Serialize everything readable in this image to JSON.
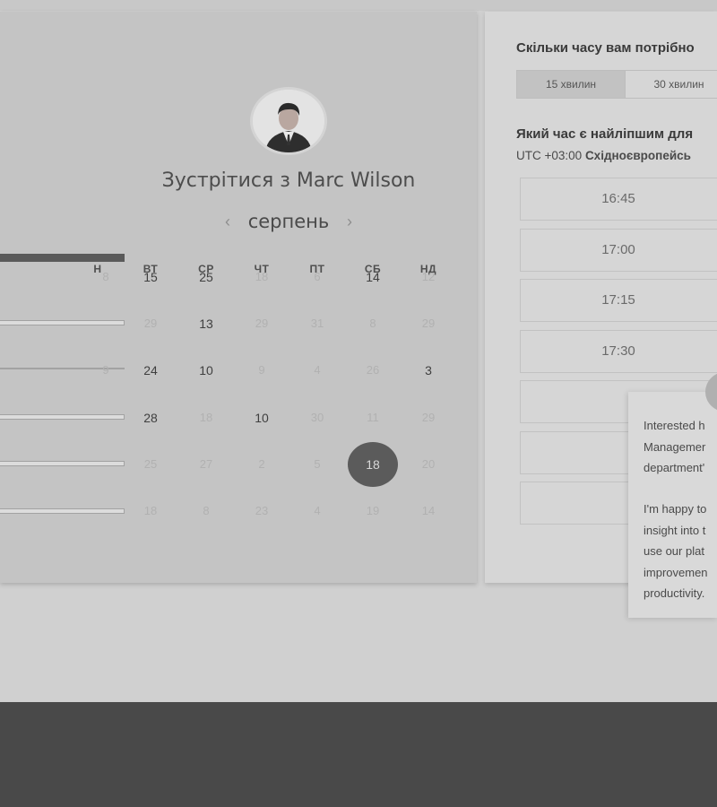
{
  "calendar": {
    "title": "Зустрітися з Marc Wilson",
    "month": "серпень",
    "prev_icon": "‹",
    "next_icon": "›",
    "weekdays": [
      "Н",
      "ВТ",
      "СР",
      "ЧТ",
      "ПТ",
      "СБ",
      "НД"
    ],
    "weeks": [
      [
        "8",
        "15",
        "25",
        "18",
        "6",
        "14",
        "12"
      ],
      [
        "29",
        "13",
        "29",
        "31",
        "8",
        "29"
      ],
      [
        "9",
        "24",
        "10",
        "9",
        "4",
        "26",
        "3"
      ],
      [
        "28",
        "18",
        "10",
        "30",
        "11",
        "29"
      ],
      [
        "25",
        "27",
        "2",
        "5",
        "18",
        "20"
      ],
      [
        "18",
        "8",
        "23",
        "4",
        "19",
        "14"
      ]
    ],
    "selected_day": "18"
  },
  "scheduler": {
    "duration_question": "Скільки часу вам потрібно",
    "durations": [
      "15 хвилин",
      "30 хвилин"
    ],
    "active_duration": "15 хвилин",
    "time_question": "Який час є найліпшим для",
    "timezone_prefix": "UTC +03:00",
    "timezone_name": "Східноєвропейсь",
    "slots": [
      "16:45",
      "17:00",
      "17:15",
      "17:30",
      "",
      "",
      ""
    ]
  },
  "chat": {
    "paragraph_1": "Interested h\nManagemer\ndepartment'",
    "paragraph_2": "I'm happy to\ninsight into t\nuse our plat\nimprovemen\nproductivity."
  },
  "colors": {
    "selected_day": "#5b5b5b",
    "footer": "#494949"
  }
}
